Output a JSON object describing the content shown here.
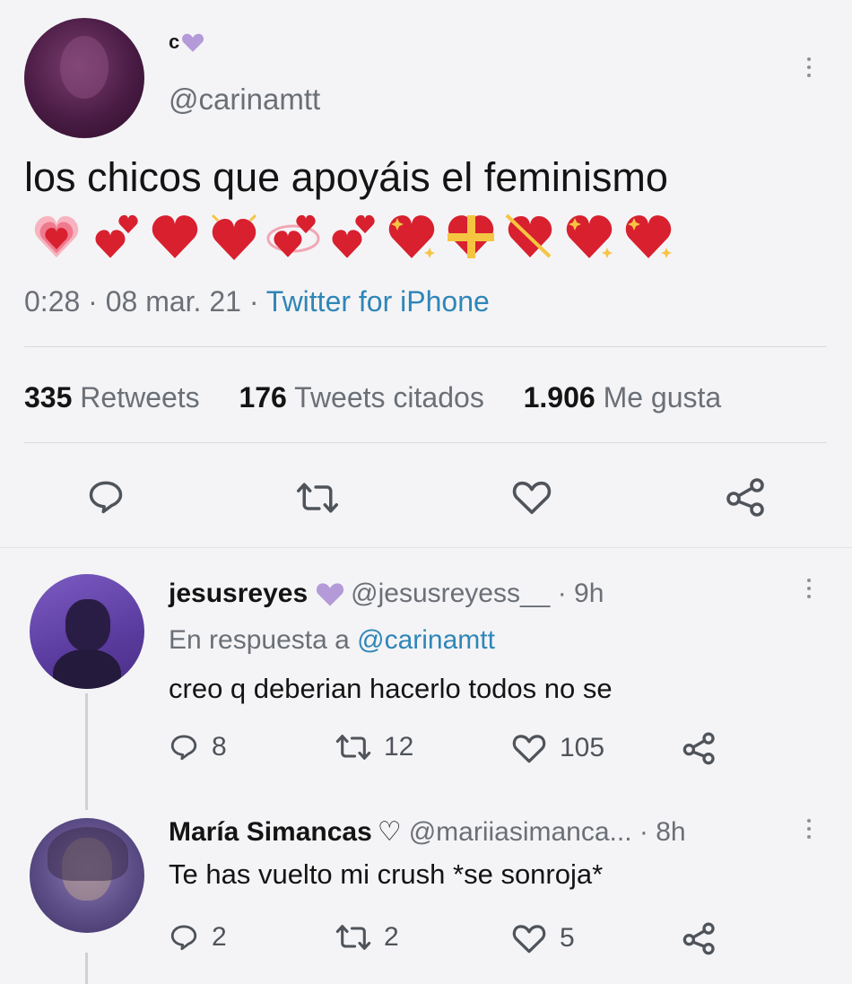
{
  "tweet": {
    "display_name": "c",
    "handle": "@carinamtt",
    "text": "los chicos que apoyáis el feminismo",
    "emojis": [
      "growing-heart",
      "two-hearts",
      "red-heart",
      "beating-heart",
      "revolving-hearts",
      "two-hearts",
      "sparkling-heart",
      "heart-with-ribbon",
      "heart-with-arrow",
      "sparkling-heart",
      "sparkling-heart"
    ],
    "time": "0:28",
    "date": "08 mar. 21",
    "source": "Twitter for iPhone",
    "stats": {
      "retweets_count": "335",
      "retweets_label": "Retweets",
      "quotes_count": "176",
      "quotes_label": "Tweets citados",
      "likes_count": "1.906",
      "likes_label": "Me gusta"
    },
    "actions": [
      "reply-icon",
      "retweet-icon",
      "like-icon",
      "share-icon"
    ]
  },
  "replies": [
    {
      "name": "jesusreyes",
      "handle": "@jesusreyess__",
      "time": "9h",
      "replying_prefix": "En respuesta a",
      "replying_to": "@carinamtt",
      "text": "creo q deberian hacerlo todos no se",
      "reply_count": "8",
      "retweet_count": "12",
      "like_count": "105"
    },
    {
      "name": "María Simancas",
      "name_suffix": "♡",
      "handle": "@mariiasimanca...",
      "time": "8h",
      "text": "Te has vuelto mi crush *se sonroja*",
      "reply_count": "2",
      "retweet_count": "2",
      "like_count": "5"
    }
  ],
  "colors": {
    "heart_purple": "#b49ad8",
    "link_blue": "#2f86b8",
    "emoji_red": "#d8202f"
  }
}
